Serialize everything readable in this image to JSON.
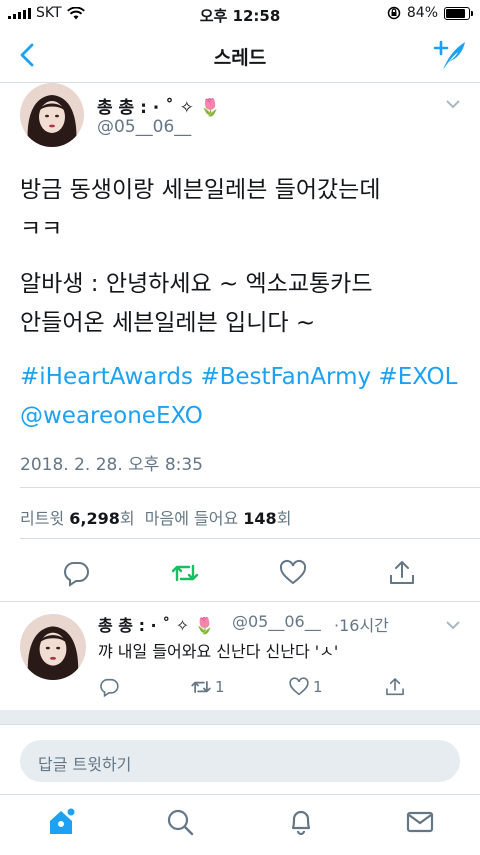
{
  "status": {
    "carrier": "SKT",
    "time": "오후 12:58",
    "battery": "84%",
    "battery_level": 0.84
  },
  "nav": {
    "title": "스레드"
  },
  "tweet": {
    "username": "총 총 : ⋅ ˚ ✧ 🌷",
    "handle": "@05__06__",
    "line1": "방금 동생이랑 세븐일레븐 들어갔는데",
    "line2": "ㅋㅋ",
    "line3": "알바생 : 안녕하세요 ~ 엑소교통카드",
    "line4": "안들어온 세븐일레븐 입니다 ~",
    "hashtags_line1": "#iHeartAwards #BestFanArmy #EXOL",
    "hashtags_line2": "@weareoneEXO",
    "date": "2018. 2. 28. 오후 8:35",
    "retweet_label": "리트윗",
    "retweet_count": "6,298",
    "count_suffix": "회",
    "like_label": "마음에 들어요",
    "like_count": "148"
  },
  "reply": {
    "username": "총 총 : ⋅ ˚ ✧ 🌷",
    "handle": "@05__06__",
    "time": "·16시간",
    "text": "꺄 내일 들어와요 신난다 신난다 'ㅅ'",
    "retweet_count": "1",
    "like_count": "1"
  },
  "reply_input": {
    "placeholder": "답글 트윗하기"
  },
  "colors": {
    "accent": "#1da1f2",
    "retweet": "#17bf63",
    "muted": "#657786"
  },
  "icons": [
    "back-icon",
    "compose-icon",
    "chevron-down-icon",
    "reply-icon",
    "retweet-icon",
    "heart-icon",
    "share-icon",
    "home-icon",
    "search-icon",
    "bell-icon",
    "mail-icon"
  ]
}
